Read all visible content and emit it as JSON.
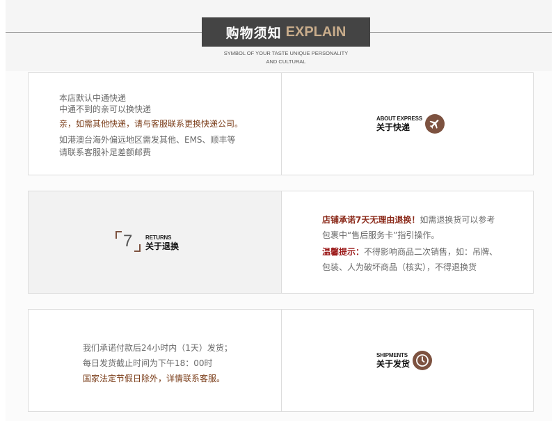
{
  "header": {
    "title_cn": "购物须知",
    "title_en": "EXPLAIN",
    "subtitle_line1": "SYMBOL OF YOUR TASTE UNIQUE PERSONALITY",
    "subtitle_line2": "AND CULTURAL"
  },
  "express": {
    "line1": "本店默认中通快递",
    "line2": "中通不到的亲可以换快递",
    "line3": "亲，如需其他快递，请与客服联系更换快递公司。",
    "line4": "如港澳台海外偏远地区需发其他、EMS、顺丰等",
    "line5": "请联系客服补足差额邮费",
    "badge_en": "ABOUT EXPRESS",
    "badge_cn": "关于快递",
    "icon": "airplane-icon"
  },
  "returns": {
    "badge_number": "7",
    "badge_en": "RETURNS",
    "badge_cn": "关于退换",
    "line1_highlight": "店铺承诺7天无理由退换！",
    "line1_rest": "如需退换货可以参考",
    "line2": "包裹中“售后服务卡”指引操作。",
    "line3_highlight": "温馨提示：",
    "line3_rest": "不得影响商品二次销售，如：吊牌、",
    "line4": "包装、人为破坏商品（核实），不得退换货"
  },
  "shipments": {
    "line1": "我们承诺付款后24小时内（1天）发货；",
    "line2": "每日发货截止时间为下午18：00时",
    "line3": "国家法定节假日除外，详情联系客服。",
    "badge_en": "SHIPMENTS",
    "badge_cn": "关于发货",
    "icon": "clock-icon"
  },
  "colors": {
    "title_bg": "#444444",
    "title_accent": "#c9ad8c",
    "icon_brown": "#7d5240",
    "highlight_red": "#9c1b1b"
  }
}
